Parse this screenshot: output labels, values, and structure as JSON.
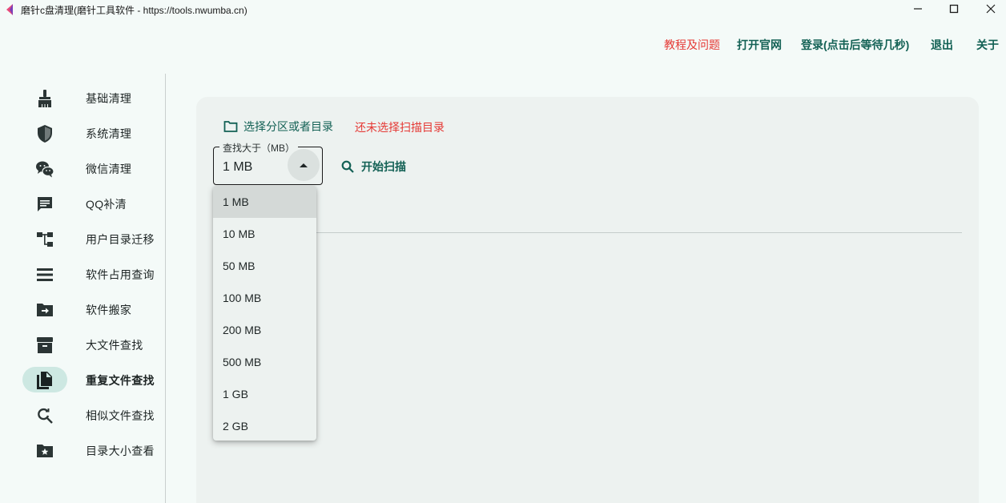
{
  "window": {
    "title": "磨针c盘清理(磨针工具软件 - https://tools.nwumba.cn)"
  },
  "topnav": {
    "tutorial": "教程及问题",
    "website": "打开官网",
    "login": "登录(点击后等待几秒)",
    "logout": "退出",
    "about": "关于"
  },
  "sidebar": {
    "items": [
      {
        "label": "基础清理",
        "icon": "broom-icon"
      },
      {
        "label": "系统清理",
        "icon": "shield-icon"
      },
      {
        "label": "微信清理",
        "icon": "wechat-icon"
      },
      {
        "label": "QQ补清",
        "icon": "chat-icon"
      },
      {
        "label": "用户目录迁移",
        "icon": "tree-icon"
      },
      {
        "label": "软件占用查询",
        "icon": "list-icon"
      },
      {
        "label": "软件搬家",
        "icon": "folder-move-icon"
      },
      {
        "label": "大文件查找",
        "icon": "archive-icon"
      },
      {
        "label": "重复文件查找",
        "icon": "copy-file-icon",
        "selected": true
      },
      {
        "label": "相似文件查找",
        "icon": "find-replace-icon"
      },
      {
        "label": "目录大小查看",
        "icon": "folder-star-icon"
      }
    ]
  },
  "main": {
    "select_dir_label": "选择分区或者目录",
    "no_dir_status": "还未选择扫描目录",
    "size_field_label": "查找大于（MB）",
    "size_value": "1 MB",
    "scan_label": "开始扫描",
    "dropdown_options": [
      "1 MB",
      "10 MB",
      "50 MB",
      "100 MB",
      "200 MB",
      "500 MB",
      "1 GB",
      "2 GB"
    ],
    "selected_option": "1 MB"
  },
  "colors": {
    "accent": "#136155",
    "warning": "#e53935",
    "background": "#f4faf8",
    "card": "#edf2f0",
    "selected_pill": "#cde8e2"
  }
}
